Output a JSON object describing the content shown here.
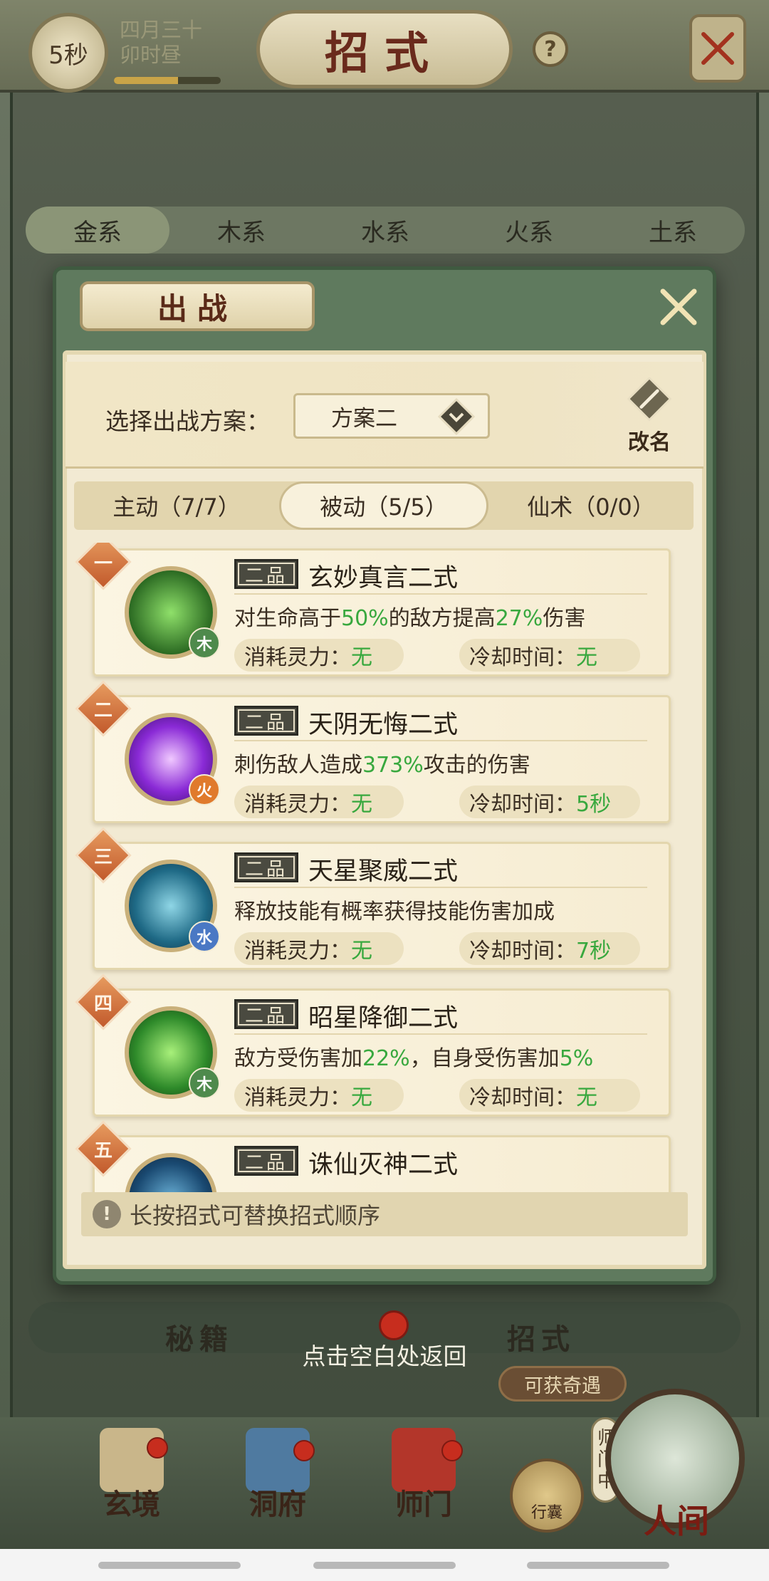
{
  "header": {
    "timer": "5秒",
    "date_line1": "四月三十",
    "date_line2": "卯时昼",
    "date_progress": 0.6,
    "title": "招式",
    "help_label": "?"
  },
  "element_tabs": [
    "金系",
    "木系",
    "水系",
    "火系",
    "土系"
  ],
  "modal": {
    "title": "出战",
    "scheme_label": "选择出战方案：",
    "scheme_value": "方案二",
    "rename_label": "改名",
    "tabs": [
      {
        "label": "主动（7/7）",
        "active": false
      },
      {
        "label": "被动（5/5）",
        "active": true
      },
      {
        "label": "仙术（0/0）",
        "active": false
      }
    ],
    "skills": [
      {
        "rank": "一",
        "grade": "二品",
        "name": "玄妙真言二式",
        "desc_parts": [
          "对生命高于",
          "50%",
          "的敌方提高",
          "27%",
          "伤害"
        ],
        "element": "木",
        "element_color": "#4e8a4c",
        "cost_label": "消耗灵力：",
        "cost_value": "无",
        "cd_label": "冷却时间：",
        "cd_value": "无",
        "icon": "green-spirit-icon"
      },
      {
        "rank": "二",
        "grade": "二品",
        "name": "天阴无悔二式",
        "desc_parts": [
          "刺伤敌人造成",
          "373%",
          "攻击的伤害",
          "",
          ""
        ],
        "element": "火",
        "element_color": "#e07a2c",
        "cost_label": "消耗灵力：",
        "cost_value": "无",
        "cd_label": "冷却时间：",
        "cd_value": "5秒",
        "icon": "purple-slash-icon"
      },
      {
        "rank": "三",
        "grade": "二品",
        "name": "天星聚威二式",
        "desc_parts": [
          "释放技能有概率获得技能伤害加成",
          "",
          "",
          "",
          ""
        ],
        "element": "水",
        "element_color": "#4a78c4",
        "cost_label": "消耗灵力：",
        "cost_value": "无",
        "cd_label": "冷却时间：",
        "cd_value": "7秒",
        "icon": "blue-warrior-icon"
      },
      {
        "rank": "四",
        "grade": "二品",
        "name": "昭星降御二式",
        "desc_parts": [
          "敌方受伤害加",
          "22%",
          "，自身受伤害加",
          "5%",
          ""
        ],
        "element": "木",
        "element_color": "#4e8a4c",
        "cost_label": "消耗灵力：",
        "cost_value": "无",
        "cd_label": "冷却时间：",
        "cd_value": "无",
        "icon": "green-tree-icon"
      },
      {
        "rank": "五",
        "grade": "二品",
        "name": "诛仙灭神二式",
        "desc_parts": [
          "",
          "",
          "",
          "",
          ""
        ],
        "element": "",
        "element_color": "#4a78c4",
        "cost_label": "",
        "cost_value": "",
        "cd_label": "",
        "cd_value": "",
        "icon": "blue-blade-icon"
      }
    ],
    "tip": "长按招式可替换招式顺序"
  },
  "sub_tabs": {
    "secret": "秘籍",
    "moves": "招式"
  },
  "tap_hint": "点击空白处返回",
  "encounter_tag": "可获奇遇",
  "bottom_nav": {
    "items": [
      "玄境",
      "洞府",
      "师门"
    ],
    "bag_label": "行囊",
    "sect_badge": "师门中",
    "world_label": "人间"
  },
  "colors": {
    "highlight_green": "#38a83e",
    "rank_orange": "#c25a2c",
    "modal_green": "#5f7a5e"
  }
}
